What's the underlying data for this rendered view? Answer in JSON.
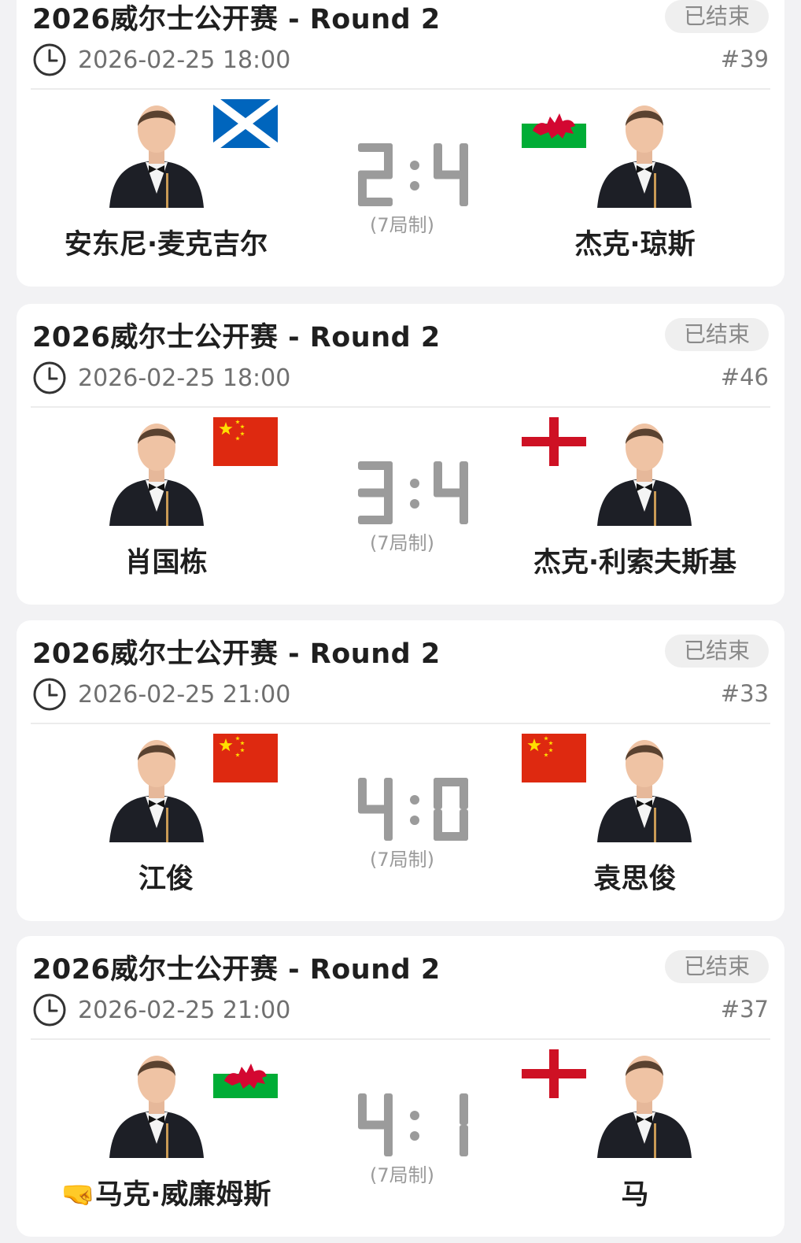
{
  "colors": {
    "card_bg": "#ffffff",
    "page_bg": "#f2f2f4",
    "digit_gray": "#9b9b9b",
    "status_bg": "#efefef",
    "flag_red": "#de2910",
    "flag_blue": "#0065bd",
    "flag_green": "#00ad36",
    "england_red": "#ce1124"
  },
  "matches": [
    {
      "title": "2026威尔士公开赛 - Round 2",
      "status": "已结束",
      "time": "2026-02-25 18:00",
      "match_no": "#39",
      "left_player": {
        "name": "安东尼·麦克吉尔",
        "flag": "scotland-flag",
        "icon": "player-photo"
      },
      "right_player": {
        "name": "杰克·琼斯",
        "flag": "wales-flag",
        "icon": "player-photo"
      },
      "score_left": 2,
      "score_right": 4,
      "format": "(7局制)"
    },
    {
      "title": "2026威尔士公开赛 - Round 2",
      "status": "已结束",
      "time": "2026-02-25 18:00",
      "match_no": "#46",
      "left_player": {
        "name": "肖国栋",
        "flag": "china-flag",
        "icon": "player-photo"
      },
      "right_player": {
        "name": "杰克·利索夫斯基",
        "flag": "england-flag",
        "icon": "player-photo"
      },
      "score_left": 3,
      "score_right": 4,
      "format": "(7局制)"
    },
    {
      "title": "2026威尔士公开赛 - Round 2",
      "status": "已结束",
      "time": "2026-02-25 21:00",
      "match_no": "#33",
      "left_player": {
        "name": "江俊",
        "flag": "china-flag",
        "icon": "player-photo"
      },
      "right_player": {
        "name": "袁思俊",
        "flag": "china-flag",
        "icon": "player-photo"
      },
      "score_left": 4,
      "score_right": 0,
      "format": "(7局制)"
    },
    {
      "title": "2026威尔士公开赛 - Round 2",
      "status": "已结束",
      "time": "2026-02-25 21:00",
      "match_no": "#37",
      "left_player": {
        "name": "马克·威廉姆斯",
        "prefix_emoji": "🤜",
        "flag": "wales-flag",
        "icon": "player-photo"
      },
      "right_player": {
        "name": "马",
        "flag": "england-flag",
        "icon": "player-photo"
      },
      "score_left": 4,
      "score_right": 1,
      "format": "(7局制)"
    }
  ]
}
